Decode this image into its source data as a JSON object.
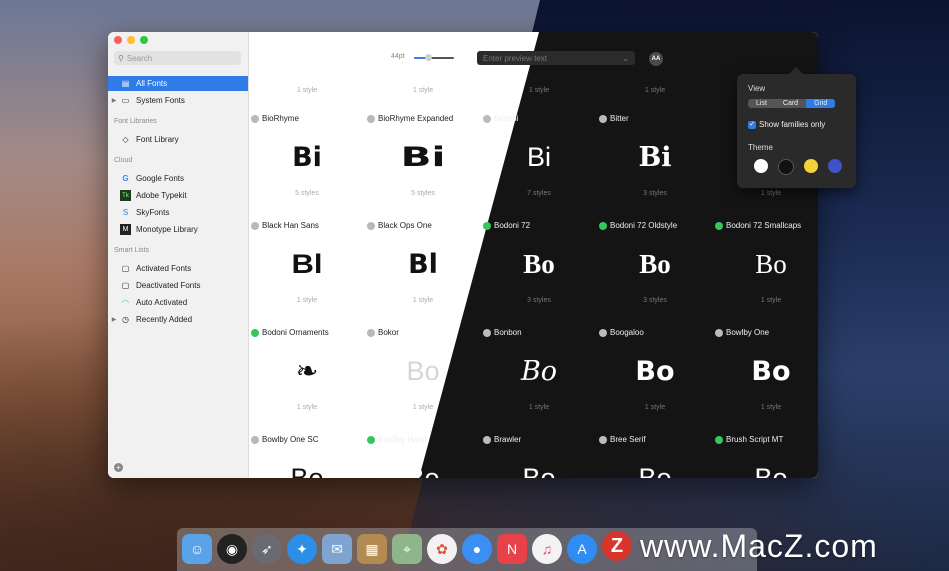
{
  "sidebar": {
    "search_placeholder": "Search",
    "all_fonts": "All Fonts",
    "system_fonts": "System Fonts",
    "section_font_libraries": "Font Libraries",
    "font_library": "Font Library",
    "section_cloud": "Cloud",
    "cloud": [
      "Google Fonts",
      "Adobe Typekit",
      "SkyFonts",
      "Monotype Library"
    ],
    "section_smart_lists": "Smart Lists",
    "smart": [
      "Activated Fonts",
      "Deactivated Fonts",
      "Auto Activated",
      "Recently Added"
    ]
  },
  "toolbar": {
    "size_label": "44pt",
    "size_value": 0.35,
    "preview_placeholder": "Enter preview text",
    "aa_label": "AA"
  },
  "grid": {
    "top_row_styles": [
      "1 style",
      "1 style",
      "1 style",
      "1 style",
      "1 style"
    ],
    "cells": [
      {
        "name": "BioRhyme",
        "sample": "Bi",
        "styles": "5 styles",
        "active": false
      },
      {
        "name": "BioRhyme Expanded",
        "sample": "Bi",
        "styles": "5 styles",
        "active": false
      },
      {
        "name": "Biryani",
        "sample": "Bi",
        "styles": "7 styles",
        "active": false
      },
      {
        "name": "Bitter",
        "sample": "Bi",
        "styles": "3 styles",
        "active": false
      },
      {
        "name": "",
        "sample": "",
        "styles": "1 style",
        "active": false
      },
      {
        "name": "Black Han Sans",
        "sample": "Bl",
        "styles": "1 style",
        "active": false
      },
      {
        "name": "Black Ops One",
        "sample": "Bl",
        "styles": "1 style",
        "active": false
      },
      {
        "name": "Bodoni 72",
        "sample": "Bo",
        "styles": "3 styles",
        "active": true
      },
      {
        "name": "Bodoni 72 Oldstyle",
        "sample": "Bo",
        "styles": "3 styles",
        "active": true
      },
      {
        "name": "Bodoni 72 Smallcaps",
        "sample": "Bo",
        "styles": "1 style",
        "active": true
      },
      {
        "name": "Bodoni Ornaments",
        "sample": "❧",
        "styles": "1 style",
        "active": true
      },
      {
        "name": "Bokor",
        "sample": "Bo",
        "styles": "1 style",
        "active": false
      },
      {
        "name": "Bonbon",
        "sample": "Bo",
        "styles": "1 style",
        "active": false
      },
      {
        "name": "Boogaloo",
        "sample": "Bo",
        "styles": "1 style",
        "active": false
      },
      {
        "name": "Bowlby One",
        "sample": "Bo",
        "styles": "1 style",
        "active": false
      },
      {
        "name": "Bowlby One SC",
        "sample": "Bo",
        "styles": "",
        "active": false
      },
      {
        "name": "Bradley Hand",
        "sample": "Bo",
        "styles": "",
        "active": true
      },
      {
        "name": "Brawler",
        "sample": "Bo",
        "styles": "",
        "active": false
      },
      {
        "name": "Bree Serif",
        "sample": "Bo",
        "styles": "",
        "active": false
      },
      {
        "name": "Brush Script MT",
        "sample": "Bo",
        "styles": "",
        "active": true
      }
    ]
  },
  "popover": {
    "view_title": "View",
    "view_options": [
      "List",
      "Card",
      "Grid"
    ],
    "view_selected": "Grid",
    "show_families_label": "Show families only",
    "show_families_checked": true,
    "theme_title": "Theme",
    "theme_colors": [
      "#ffffff",
      "#111111",
      "#f2d33b",
      "#3f52c8"
    ]
  },
  "colors": {
    "accent": "#2f7be7",
    "active_dot": "#34c759",
    "inactive_dot": "#b9b9b9"
  },
  "watermark": {
    "text": "www.MacZ.com",
    "logo_letter": "Z"
  }
}
